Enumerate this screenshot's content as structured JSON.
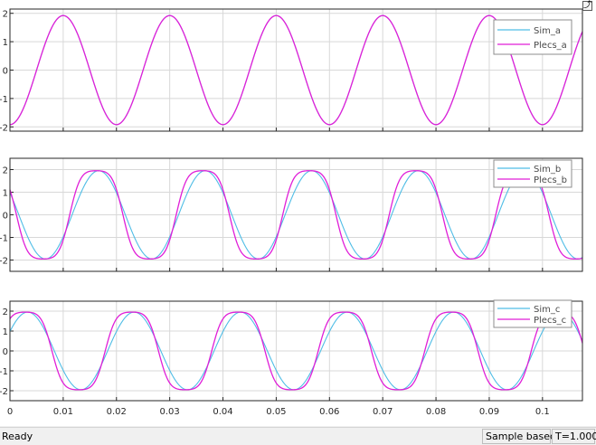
{
  "window": {
    "dock_icon": "undock-icon",
    "dock_glyph": "⤴"
  },
  "colors": {
    "sim": "#4fbde6",
    "plecs": "#e01fd8",
    "grid": "#d8d8d8",
    "axis": "#262626"
  },
  "chart_data": [
    {
      "type": "line",
      "xlim": [
        0,
        0.1075
      ],
      "ylim": [
        -2.15,
        2.15
      ],
      "yticks": [
        -2,
        -1,
        0,
        1,
        2
      ],
      "ytick_labels": [
        "-2",
        "-1",
        "0",
        "1",
        "2"
      ],
      "grid": true,
      "legend": "top-right",
      "series": [
        {
          "name": "Sim_a",
          "color": "#4fbde6",
          "func": "sin",
          "amplitude": 1.92,
          "frequency": 50,
          "phase_deg": -90,
          "distortion": 0
        },
        {
          "name": "Plecs_a",
          "color": "#e01fd8",
          "func": "sin",
          "amplitude": 1.92,
          "frequency": 50,
          "phase_deg": -90,
          "distortion": 0
        }
      ]
    },
    {
      "type": "line",
      "xlim": [
        0,
        0.1075
      ],
      "ylim": [
        -2.5,
        2.5
      ],
      "yticks": [
        -2,
        -1,
        0,
        1,
        2
      ],
      "ytick_labels": [
        "-2",
        "-1",
        "0",
        "1",
        "2"
      ],
      "grid": true,
      "legend": "top-right",
      "series": [
        {
          "name": "Sim_b",
          "color": "#4fbde6",
          "func": "sin",
          "amplitude": 1.95,
          "frequency": 50,
          "phase_deg": 150,
          "distortion": 0
        },
        {
          "name": "Plecs_b",
          "color": "#e01fd8",
          "func": "sin",
          "amplitude": 1.95,
          "frequency": 50,
          "phase_deg": 158,
          "distortion": 0.32
        }
      ]
    },
    {
      "type": "line",
      "xlim": [
        0,
        0.1075
      ],
      "ylim": [
        -2.5,
        2.5
      ],
      "yticks": [
        -2,
        -1,
        0,
        1,
        2
      ],
      "ytick_labels": [
        "-2",
        "-1",
        "0",
        "1",
        "2"
      ],
      "xticks": [
        0,
        0.01,
        0.02,
        0.03,
        0.04,
        0.05,
        0.06,
        0.07,
        0.08,
        0.09,
        0.1
      ],
      "xtick_labels": [
        "0",
        "0.01",
        "0.02",
        "0.03",
        "0.04",
        "0.05",
        "0.06",
        "0.07",
        "0.08",
        "0.09",
        "0.1"
      ],
      "grid": true,
      "legend": "top-right",
      "series": [
        {
          "name": "Sim_c",
          "color": "#4fbde6",
          "func": "sin",
          "amplitude": 1.95,
          "frequency": 50,
          "phase_deg": 30,
          "distortion": 0
        },
        {
          "name": "Plecs_c",
          "color": "#e01fd8",
          "func": "sin",
          "amplitude": 1.95,
          "frequency": 50,
          "phase_deg": 38,
          "distortion": 0.32
        }
      ]
    }
  ],
  "status_bar": {
    "status": "Ready",
    "sample_mode": "Sample based",
    "time": "T=1.000"
  }
}
